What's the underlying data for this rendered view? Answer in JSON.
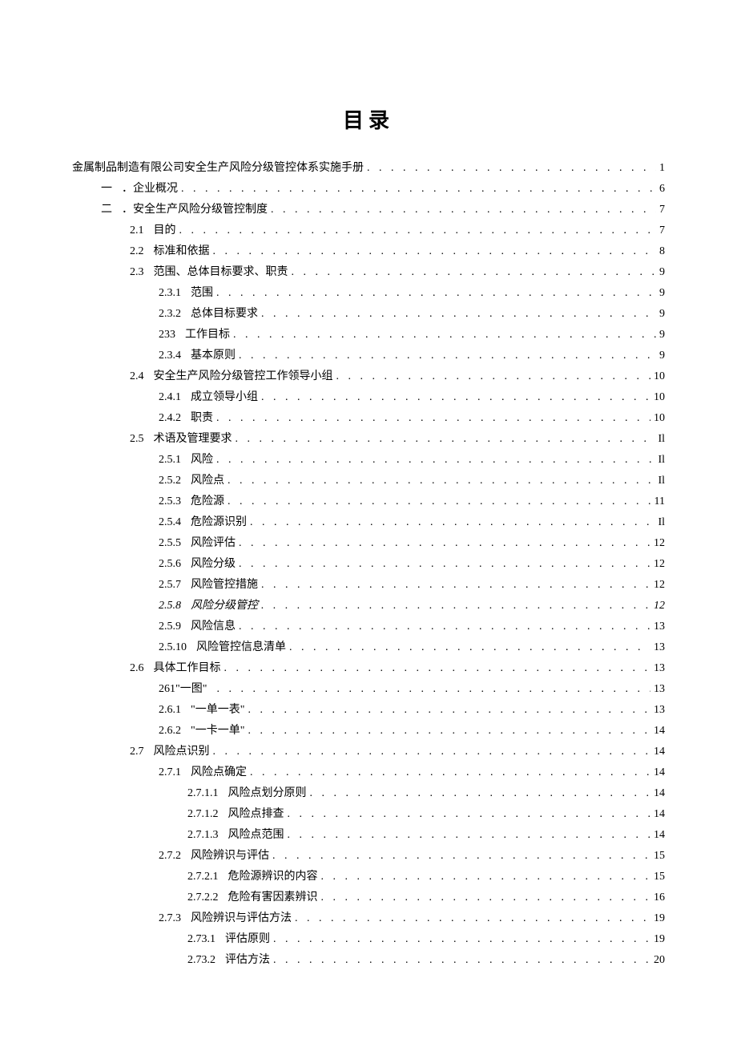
{
  "title": "目录",
  "toc": [
    {
      "level": 0,
      "num": "",
      "text": "金属制品制造有限公司安全生产风险分级管控体系实施手册",
      "page": "1"
    },
    {
      "level": 1,
      "num": "一",
      "text": "．企业概况",
      "page": "6"
    },
    {
      "level": 1,
      "num": "二",
      "text": "．安全生产风险分级管控制度",
      "page": "7"
    },
    {
      "level": 2,
      "num": "2.1",
      "text": "目的",
      "page": "7"
    },
    {
      "level": 2,
      "num": "2.2",
      "text": "标准和依据",
      "page": "8"
    },
    {
      "level": 2,
      "num": "2.3",
      "text": "范围、总体目标要求、职责",
      "page": "9"
    },
    {
      "level": 3,
      "num": "2.3.1",
      "text": "范围",
      "page": "9"
    },
    {
      "level": 3,
      "num": "2.3.2",
      "text": "总体目标要求",
      "page": "9"
    },
    {
      "level": 3,
      "num": "233",
      "text": "工作目标",
      "page": "9"
    },
    {
      "level": 3,
      "num": "2.3.4",
      "text": "基本原则",
      "page": "9"
    },
    {
      "level": 2,
      "num": "2.4",
      "text": "安全生产风险分级管控工作领导小组",
      "page": "10"
    },
    {
      "level": 3,
      "num": "2.4.1",
      "text": "成立领导小组",
      "page": "10"
    },
    {
      "level": 3,
      "num": "2.4.2",
      "text": "职责",
      "page": "10"
    },
    {
      "level": 2,
      "num": "2.5",
      "text": "术语及管理要求",
      "page": "Il"
    },
    {
      "level": 3,
      "num": "2.5.1",
      "text": "风险",
      "page": "Il"
    },
    {
      "level": 3,
      "num": "2.5.2",
      "text": "风险点",
      "page": "Il"
    },
    {
      "level": 3,
      "num": "2.5.3",
      "text": "危险源",
      "page": "11"
    },
    {
      "level": 3,
      "num": "2.5.4",
      "text": "危险源识别",
      "page": "Il"
    },
    {
      "level": 3,
      "num": "2.5.5",
      "text": "风险评估",
      "page": "12"
    },
    {
      "level": 3,
      "num": "2.5.6",
      "text": "风险分级",
      "page": "12"
    },
    {
      "level": 3,
      "num": "2.5.7",
      "text": "风险管控措施",
      "page": "12"
    },
    {
      "level": 3,
      "num": "2.5.8",
      "text": "风险分级管控",
      "page": "12",
      "italic": true
    },
    {
      "level": 3,
      "num": "2.5.9",
      "text": "风险信息",
      "page": "13"
    },
    {
      "level": 3,
      "num": "2.5.10",
      "text": "风险管控信息清单",
      "page": "13"
    },
    {
      "level": 2,
      "num": "2.6",
      "text": "具体工作目标",
      "page": "13"
    },
    {
      "level": 3,
      "num": "261\"一图\"",
      "text": "",
      "page": "13"
    },
    {
      "level": 3,
      "num": "2.6.1",
      "text": "\"一单一表\"",
      "page": "13"
    },
    {
      "level": 3,
      "num": "2.6.2",
      "text": "\"一卡一单\"",
      "page": "14"
    },
    {
      "level": 2,
      "num": "2.7",
      "text": "风险点识别",
      "page": "14"
    },
    {
      "level": 3,
      "num": "2.7.1",
      "text": "风险点确定",
      "page": "14"
    },
    {
      "level": 4,
      "num": "2.7.1.1",
      "text": "风险点划分原则",
      "page": "14"
    },
    {
      "level": 4,
      "num": "2.7.1.2",
      "text": "风险点排查",
      "page": "14"
    },
    {
      "level": 4,
      "num": "2.7.1.3",
      "text": "风险点范围",
      "page": "14"
    },
    {
      "level": 3,
      "num": "2.7.2",
      "text": "风险辨识与评估",
      "page": "15"
    },
    {
      "level": 4,
      "num": "2.7.2.1",
      "text": "危险源辨识的内容",
      "page": "15"
    },
    {
      "level": 4,
      "num": "2.7.2.2",
      "text": "危险有害因素辨识",
      "page": "16"
    },
    {
      "level": 3,
      "num": "2.7.3",
      "text": "风险辨识与评估方法",
      "page": "19"
    },
    {
      "level": 4,
      "num": "2.73.1",
      "text": "评估原则",
      "page": "19"
    },
    {
      "level": 4,
      "num": "2.73.2",
      "text": "评估方法",
      "page": "20"
    }
  ]
}
